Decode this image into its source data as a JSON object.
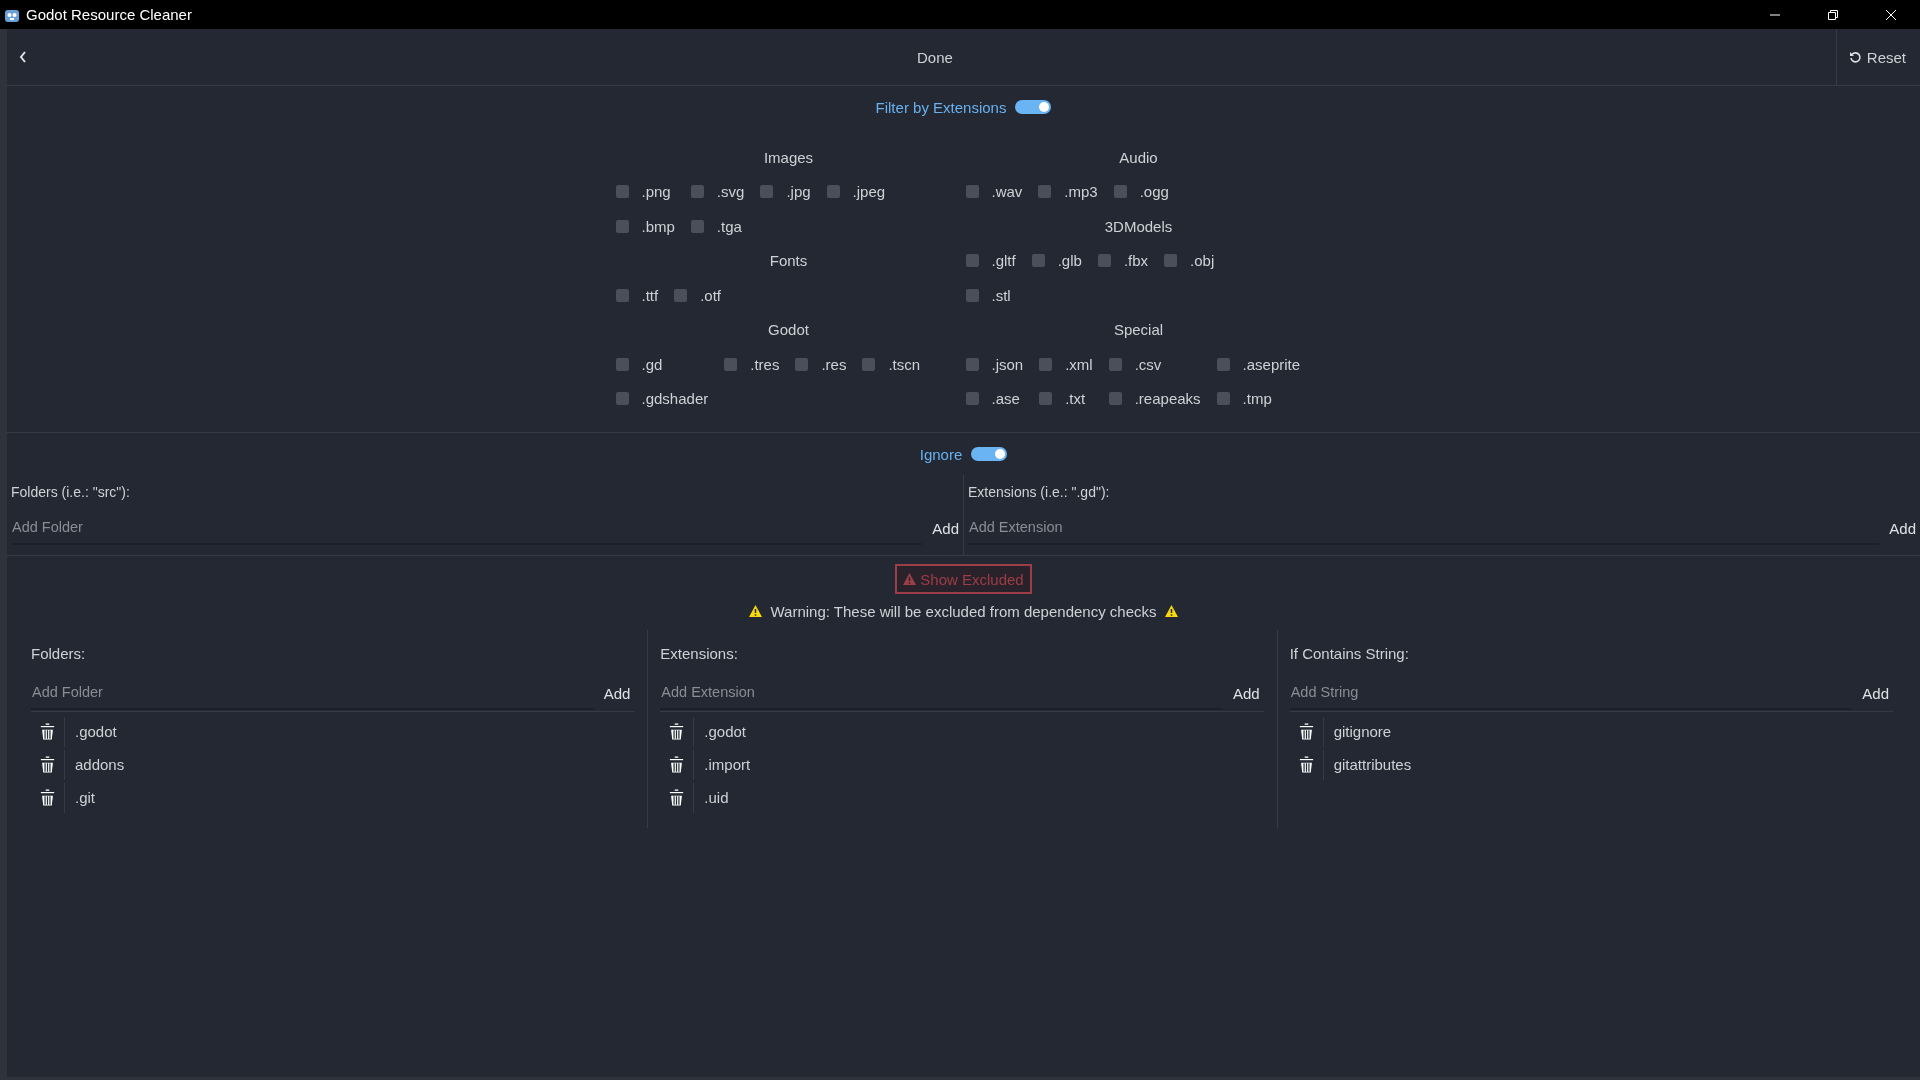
{
  "window": {
    "title": "Godot Resource Cleaner"
  },
  "toolbar": {
    "title": "Done",
    "reset": "Reset"
  },
  "filter": {
    "label": "Filter by Extensions",
    "on": true,
    "columns": [
      [
        {
          "name": "Images",
          "items": [
            {
              "label": ".png",
              "checked": false
            },
            {
              "label": ".svg",
              "checked": false
            },
            {
              "label": ".jpg",
              "checked": false
            },
            {
              "label": ".jpeg",
              "checked": false
            },
            {
              "label": ".bmp",
              "checked": false
            },
            {
              "label": ".tga",
              "checked": false
            }
          ]
        },
        {
          "name": "Fonts",
          "items": [
            {
              "label": ".ttf",
              "checked": false
            },
            {
              "label": ".otf",
              "checked": false
            }
          ]
        },
        {
          "name": "Godot",
          "items": [
            {
              "label": ".gd",
              "checked": false
            },
            {
              "label": ".tres",
              "checked": false
            },
            {
              "label": ".res",
              "checked": false
            },
            {
              "label": ".tscn",
              "checked": false
            },
            {
              "label": ".gdshader",
              "checked": false
            }
          ]
        }
      ],
      [
        {
          "name": "Audio",
          "items": [
            {
              "label": ".wav",
              "checked": false
            },
            {
              "label": ".mp3",
              "checked": false
            },
            {
              "label": ".ogg",
              "checked": false
            }
          ]
        },
        {
          "name": "3DModels",
          "items": [
            {
              "label": ".gltf",
              "checked": false
            },
            {
              "label": ".glb",
              "checked": false
            },
            {
              "label": ".fbx",
              "checked": false
            },
            {
              "label": ".obj",
              "checked": false
            },
            {
              "label": ".stl",
              "checked": false
            }
          ]
        },
        {
          "name": "Special",
          "items": [
            {
              "label": ".json",
              "checked": false
            },
            {
              "label": ".xml",
              "checked": false
            },
            {
              "label": ".csv",
              "checked": false
            },
            {
              "label": ".aseprite",
              "checked": false
            },
            {
              "label": ".ase",
              "checked": false
            },
            {
              "label": ".txt",
              "checked": false
            },
            {
              "label": ".reapeaks",
              "checked": false
            },
            {
              "label": ".tmp",
              "checked": false
            }
          ]
        }
      ]
    ]
  },
  "ignore": {
    "label": "Ignore",
    "on": true,
    "fields": [
      {
        "label": "Folders (i.e.: \"src\"):",
        "placeholder": "Add Folder",
        "button": "Add"
      },
      {
        "label": "Extensions (i.e.: \".gd\"):",
        "placeholder": "Add Extension",
        "button": "Add"
      }
    ]
  },
  "show_excluded": {
    "label": "Show Excluded"
  },
  "warning": "Warning: These will be excluded from dependency checks",
  "lists": [
    {
      "title": "Folders:",
      "placeholder": "Add Folder",
      "button": "Add",
      "entries": [
        ".godot",
        "addons",
        ".git"
      ]
    },
    {
      "title": "Extensions:",
      "placeholder": "Add Extension",
      "button": "Add",
      "entries": [
        ".godot",
        ".import",
        ".uid"
      ]
    },
    {
      "title": "If Contains String:",
      "placeholder": "Add String",
      "button": "Add",
      "entries": [
        "gitignore",
        "gitattributes"
      ]
    }
  ]
}
